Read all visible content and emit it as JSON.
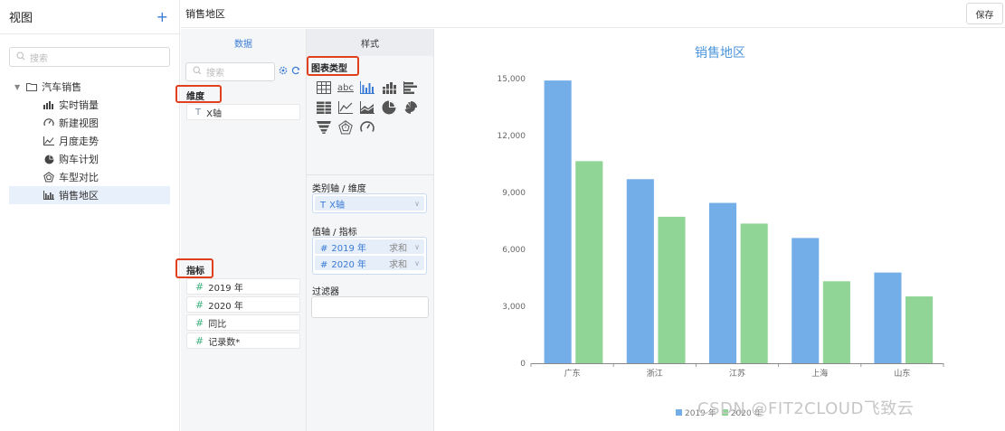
{
  "sidebar": {
    "title": "视图",
    "add_symbol": "+",
    "search_placeholder": "搜索",
    "root": "汽车销售",
    "items": [
      {
        "label": "实时销量",
        "icon": "bar-stack-icon"
      },
      {
        "label": "新建视图",
        "icon": "gauge-icon"
      },
      {
        "label": "月度走势",
        "icon": "line-chart-icon"
      },
      {
        "label": "购车计划",
        "icon": "pie-chart-icon"
      },
      {
        "label": "车型对比",
        "icon": "radar-icon"
      },
      {
        "label": "销售地区",
        "icon": "bar-chart-icon",
        "active": true
      }
    ]
  },
  "topbar": {
    "title": "销售地区",
    "save_label": "保存"
  },
  "data_panel": {
    "tab_label": "数据",
    "search_placeholder": "搜索",
    "dimension_label": "维度",
    "dimensions": [
      {
        "type": "T",
        "label": "X轴"
      }
    ],
    "metric_label": "指标",
    "metrics": [
      {
        "type": "#",
        "label": "2019 年"
      },
      {
        "type": "#",
        "label": "2020 年"
      },
      {
        "type": "#",
        "label": "同比"
      },
      {
        "type": "#",
        "label": "记录数*"
      }
    ]
  },
  "style_panel": {
    "tab_label": "样式",
    "chart_type_label": "图表类型",
    "abc_label": "abc",
    "category_axis_label": "类别轴 / 维度",
    "category_field": {
      "type": "T",
      "label": "X轴"
    },
    "value_axis_label": "值轴 / 指标",
    "value_fields": [
      {
        "type": "#",
        "label": "2019 年",
        "agg": "求和"
      },
      {
        "type": "#",
        "label": "2020 年",
        "agg": "求和"
      }
    ],
    "filter_label": "过滤器"
  },
  "watermark": "CSDN @FIT2CLOUD飞致云",
  "colors": {
    "accent": "#3a7bd5",
    "series_2019": "#74aee8",
    "series_2020": "#90d595",
    "highlight": "#e0401e"
  },
  "chart_data": {
    "type": "bar",
    "title": "销售地区",
    "categories": [
      "广东",
      "浙江",
      "江苏",
      "上海",
      "山东"
    ],
    "series": [
      {
        "name": "2019 年",
        "values": [
          14900,
          9700,
          8450,
          6600,
          4780
        ]
      },
      {
        "name": "2020 年",
        "values": [
          10650,
          7720,
          7360,
          4320,
          3520
        ]
      }
    ],
    "ylim": [
      0,
      15000
    ],
    "yticks": [
      0,
      3000,
      6000,
      9000,
      12000,
      15000
    ],
    "ytick_labels": [
      "0",
      "3,000",
      "6,000",
      "9,000",
      "12,000",
      "15,000"
    ],
    "grid": false,
    "legend": "bottom"
  }
}
